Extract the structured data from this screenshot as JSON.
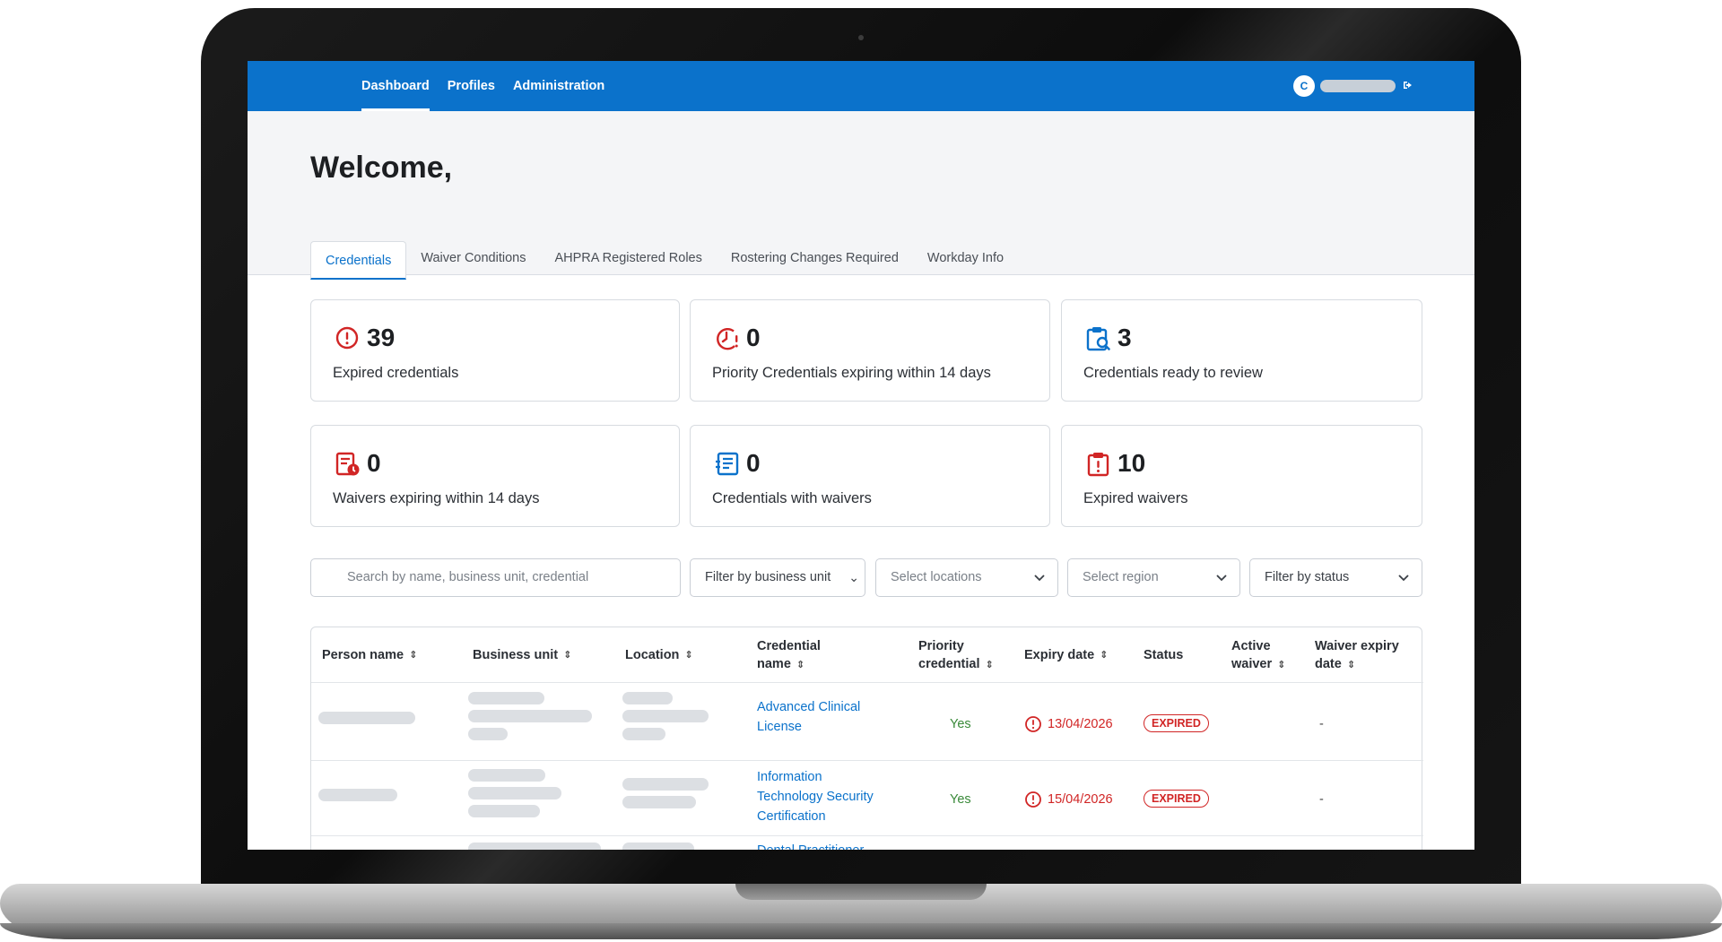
{
  "nav": {
    "items": [
      "Dashboard",
      "Profiles",
      "Administration"
    ],
    "active": "Dashboard",
    "avatar_initial": "C"
  },
  "header": {
    "welcome": "Welcome,"
  },
  "tabs": [
    "Credentials",
    "Waiver Conditions",
    "AHPRA Registered Roles",
    "Rostering Changes Required",
    "Workday Info"
  ],
  "cards": [
    {
      "value": "39",
      "label": "Expired credentials",
      "icon": "alert-circle-icon"
    },
    {
      "value": "0",
      "label": "Priority Credentials expiring within 14 days",
      "icon": "clock-alert-icon"
    },
    {
      "value": "3",
      "label": "Credentials ready to review",
      "icon": "clipboard-search-icon"
    },
    {
      "value": "0",
      "label": "Waivers expiring within 14 days",
      "icon": "document-clock-icon"
    },
    {
      "value": "0",
      "label": "Credentials with waivers",
      "icon": "document-list-icon"
    },
    {
      "value": "10",
      "label": "Expired waivers",
      "icon": "clipboard-alert-icon"
    }
  ],
  "filters": {
    "search_placeholder": "Search by name, business unit, credential",
    "business_unit": "Filter by business unit",
    "locations": "Select locations",
    "region": "Select region",
    "status": "Filter by status"
  },
  "table": {
    "headers": {
      "person": "Person name",
      "business_unit": "Business unit",
      "location": "Location",
      "credential_1": "Credential",
      "credential_2": "name",
      "priority_1": "Priority",
      "priority_2": "credential",
      "expiry": "Expiry date",
      "status": "Status",
      "active_1": "Active",
      "active_2": "waiver",
      "waiver_1": "Waiver expiry",
      "waiver_2": "date"
    },
    "rows": [
      {
        "credential_1": "Advanced Clinical",
        "credential_2": "License",
        "credential_3": "",
        "priority": "Yes",
        "expiry": "13/04/2026",
        "status": "EXPIRED",
        "waiver_expiry": "-"
      },
      {
        "credential_1": "Information",
        "credential_2": "Technology Security",
        "credential_3": "Certification",
        "priority": "Yes",
        "expiry": "15/04/2026",
        "status": "EXPIRED",
        "waiver_expiry": "-"
      },
      {
        "credential_1": "Dental Practitioner",
        "credential_2": "",
        "credential_3": "",
        "priority": "",
        "expiry": "",
        "status": "",
        "waiver_expiry": ""
      }
    ]
  },
  "colors": {
    "brand": "#0b72cb",
    "danger": "#d12525",
    "success": "#3a8a3a"
  }
}
